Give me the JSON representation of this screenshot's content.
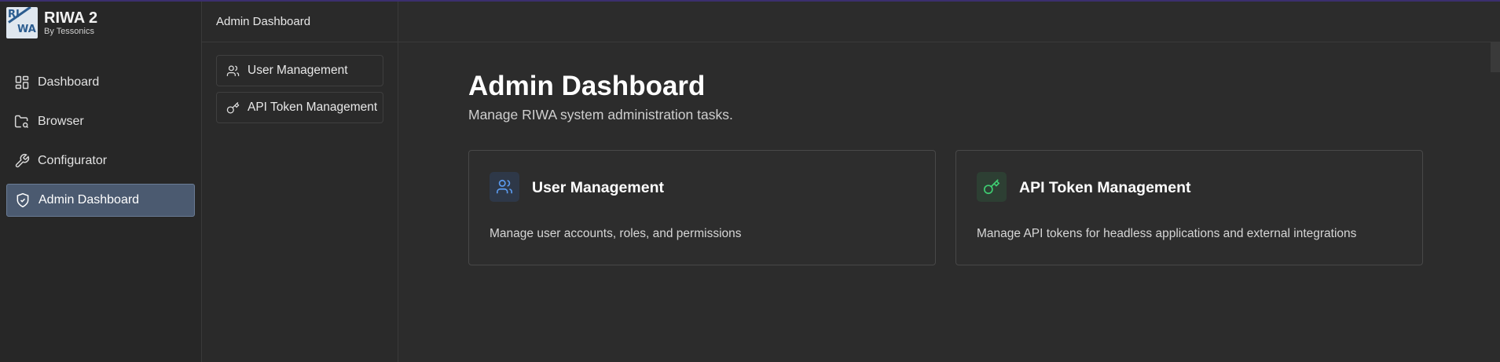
{
  "brand": {
    "title": "RIWA 2",
    "subtitle": "By Tessonics",
    "logo_top": "RI",
    "logo_bottom": "WA"
  },
  "sidebar": {
    "items": [
      {
        "label": "Dashboard",
        "icon": "dashboard-icon"
      },
      {
        "label": "Browser",
        "icon": "folder-search-icon"
      },
      {
        "label": "Configurator",
        "icon": "wrench-icon"
      },
      {
        "label": "Admin Dashboard",
        "icon": "shield-icon",
        "active": true
      }
    ]
  },
  "midcol": {
    "header": "Admin Dashboard",
    "items": [
      {
        "label": "User Management",
        "icon": "users-icon"
      },
      {
        "label": "API Token Management",
        "icon": "key-icon"
      }
    ]
  },
  "main": {
    "title": "Admin Dashboard",
    "subtitle": "Manage RIWA system administration tasks.",
    "cards": [
      {
        "title": "User Management",
        "description": "Manage user accounts, roles, and permissions",
        "icon": "users-icon",
        "icon_color": "#5b9bf0"
      },
      {
        "title": "API Token Management",
        "description": "Manage API tokens for headless applications and external integrations",
        "icon": "key-icon",
        "icon_color": "#3fce72"
      }
    ]
  },
  "colors": {
    "active_nav_bg": "#4b5a70",
    "background": "#2b2b2b",
    "topline": "#3b2f6e"
  }
}
